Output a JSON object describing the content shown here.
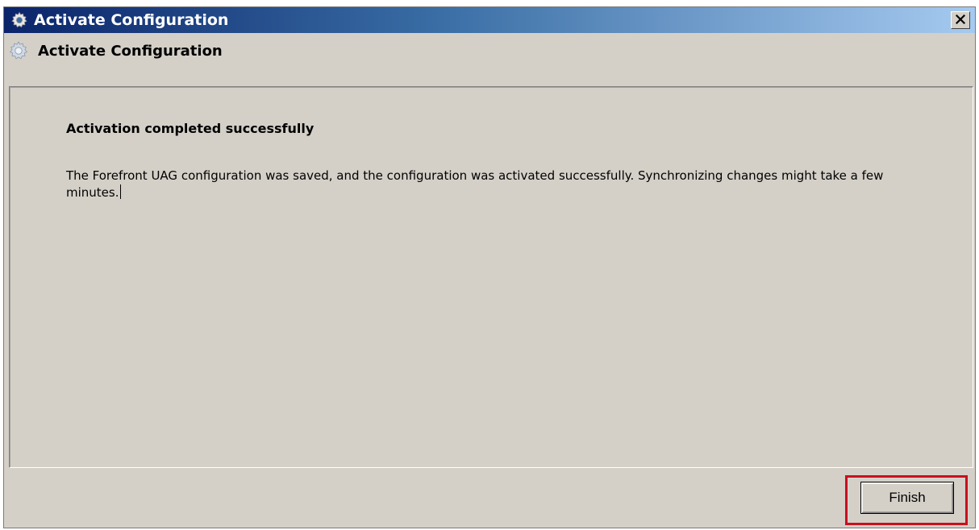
{
  "window": {
    "title": "Activate Configuration",
    "close_label": "X"
  },
  "header": {
    "title": "Activate Configuration"
  },
  "content": {
    "heading": "Activation completed successfully",
    "body": "The Forefront UAG configuration was saved, and the configuration was activated successfully. Synchronizing changes might take a few minutes."
  },
  "footer": {
    "finish_label": "Finish"
  },
  "icons": {
    "titlebar": "gear-icon",
    "header": "gear-icon",
    "close": "close-icon"
  },
  "colors": {
    "titlebar_start": "#0a246a",
    "titlebar_end": "#a6caf0",
    "window_bg": "#d4d0c8",
    "highlight": "#c8101e"
  }
}
